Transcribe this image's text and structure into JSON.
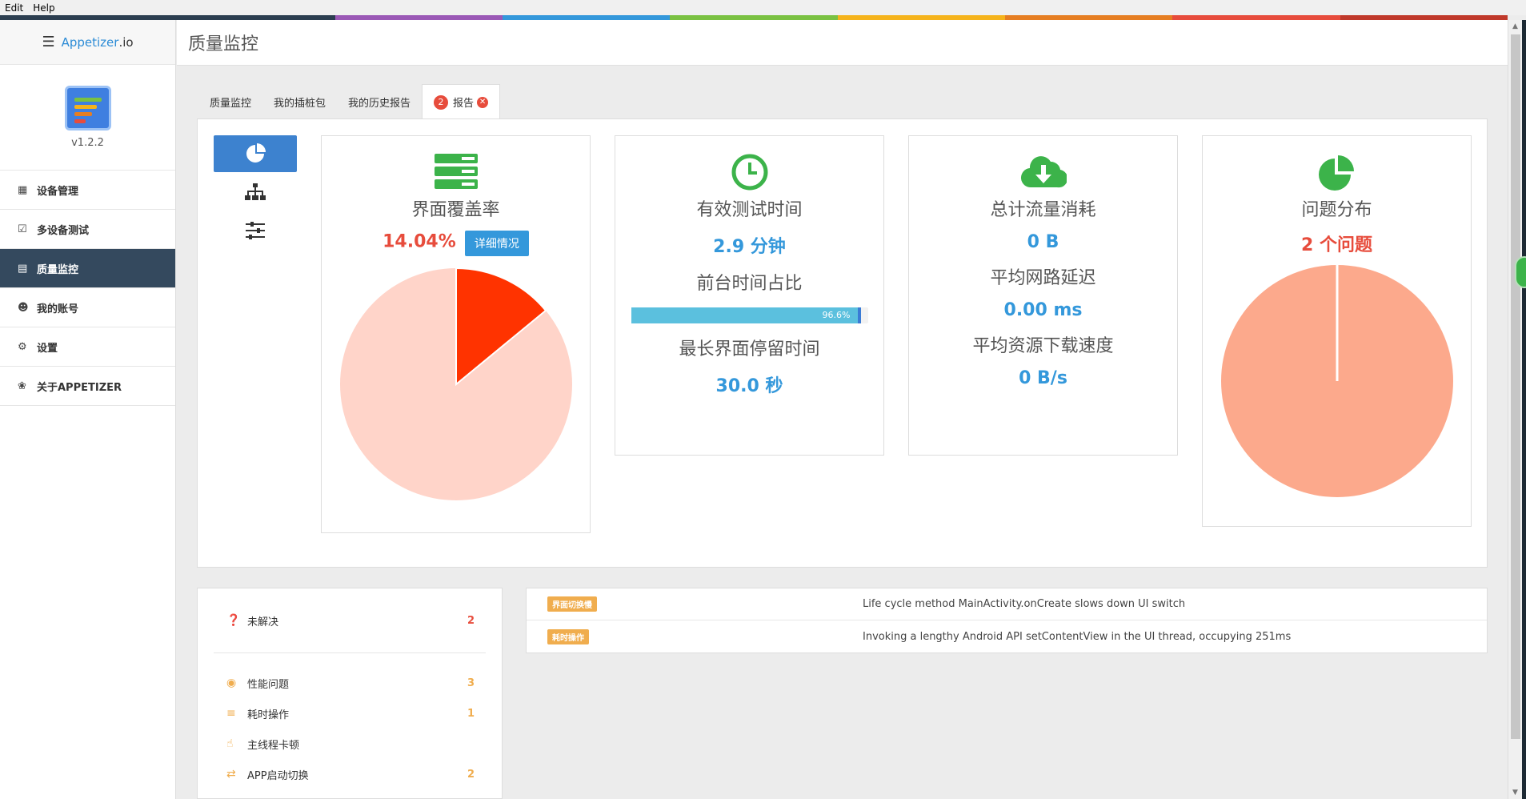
{
  "menubar": {
    "items": [
      "Edit",
      "Help"
    ]
  },
  "colors": {
    "stripe": [
      "#2c3e50",
      "#2c3e50",
      "#9b59b6",
      "#3498db",
      "#7ac142",
      "#f5b31b",
      "#e67e22",
      "#e74c3c",
      "#c0392b"
    ],
    "accent_blue": "#3498db",
    "accent_red": "#e74c3c",
    "nav_active_bg": "#34495e",
    "coverage_covered": "#ff3300",
    "coverage_uncovered": "#ffd4c9",
    "issues_pie": "#fca98c"
  },
  "sidebar": {
    "brand_prefix": "Appetizer",
    "brand_suffix": ".io",
    "version": "v1.2.2",
    "items": [
      {
        "label": "设备管理",
        "icon": "grid-icon"
      },
      {
        "label": "多设备测试",
        "icon": "checkbox-icon"
      },
      {
        "label": "质量监控",
        "icon": "list-icon",
        "active": true
      },
      {
        "label": "我的账号",
        "icon": "user-icon"
      },
      {
        "label": "设置",
        "icon": "gear-icon"
      },
      {
        "label": "关于APPETIZER",
        "icon": "leaf-icon"
      }
    ]
  },
  "header": {
    "title": "质量监控"
  },
  "tabs": [
    {
      "label": "质量监控"
    },
    {
      "label": "我的插桩包"
    },
    {
      "label": "我的历史报告"
    },
    {
      "label": "报告",
      "badge": "2",
      "active": true
    }
  ],
  "cards": {
    "coverage": {
      "title": "界面覆盖率",
      "value": "14.04%",
      "button": "详细情况",
      "covered_fraction": 0.1404
    },
    "time": {
      "title": "有效测试时间",
      "value": "2.9 分钟",
      "foreground_title": "前台时间占比",
      "foreground_percent_label": "96.6%",
      "foreground_fraction": 0.966,
      "longest_title": "最长界面停留时间",
      "longest_value": "30.0 秒"
    },
    "network": {
      "title": "总计流量消耗",
      "value": "0 B",
      "latency_title": "平均网路延迟",
      "latency_value": "0.00 ms",
      "speed_title": "平均资源下载速度",
      "speed_value": "0 B/s"
    },
    "issues": {
      "title": "问题分布",
      "value": "2 个问题"
    }
  },
  "summary": {
    "unresolved_label": "未解决",
    "unresolved_count": "2",
    "categories": [
      {
        "label": "性能问题",
        "count": "3",
        "icon": "dashboard-icon"
      },
      {
        "label": "耗时操作",
        "count": "1",
        "icon": "sliders-icon"
      },
      {
        "label": "主线程卡顿",
        "count": "",
        "icon": "hand-icon"
      },
      {
        "label": "APP启动切换",
        "count": "2",
        "icon": "swap-icon"
      }
    ]
  },
  "issues": [
    {
      "tag": "界面切换慢",
      "message": "Life cycle method MainActivity.onCreate slows down UI switch"
    },
    {
      "tag": "耗时操作",
      "message": "Invoking a lengthy Android API setContentView in the UI thread, occupying 251ms"
    }
  ]
}
